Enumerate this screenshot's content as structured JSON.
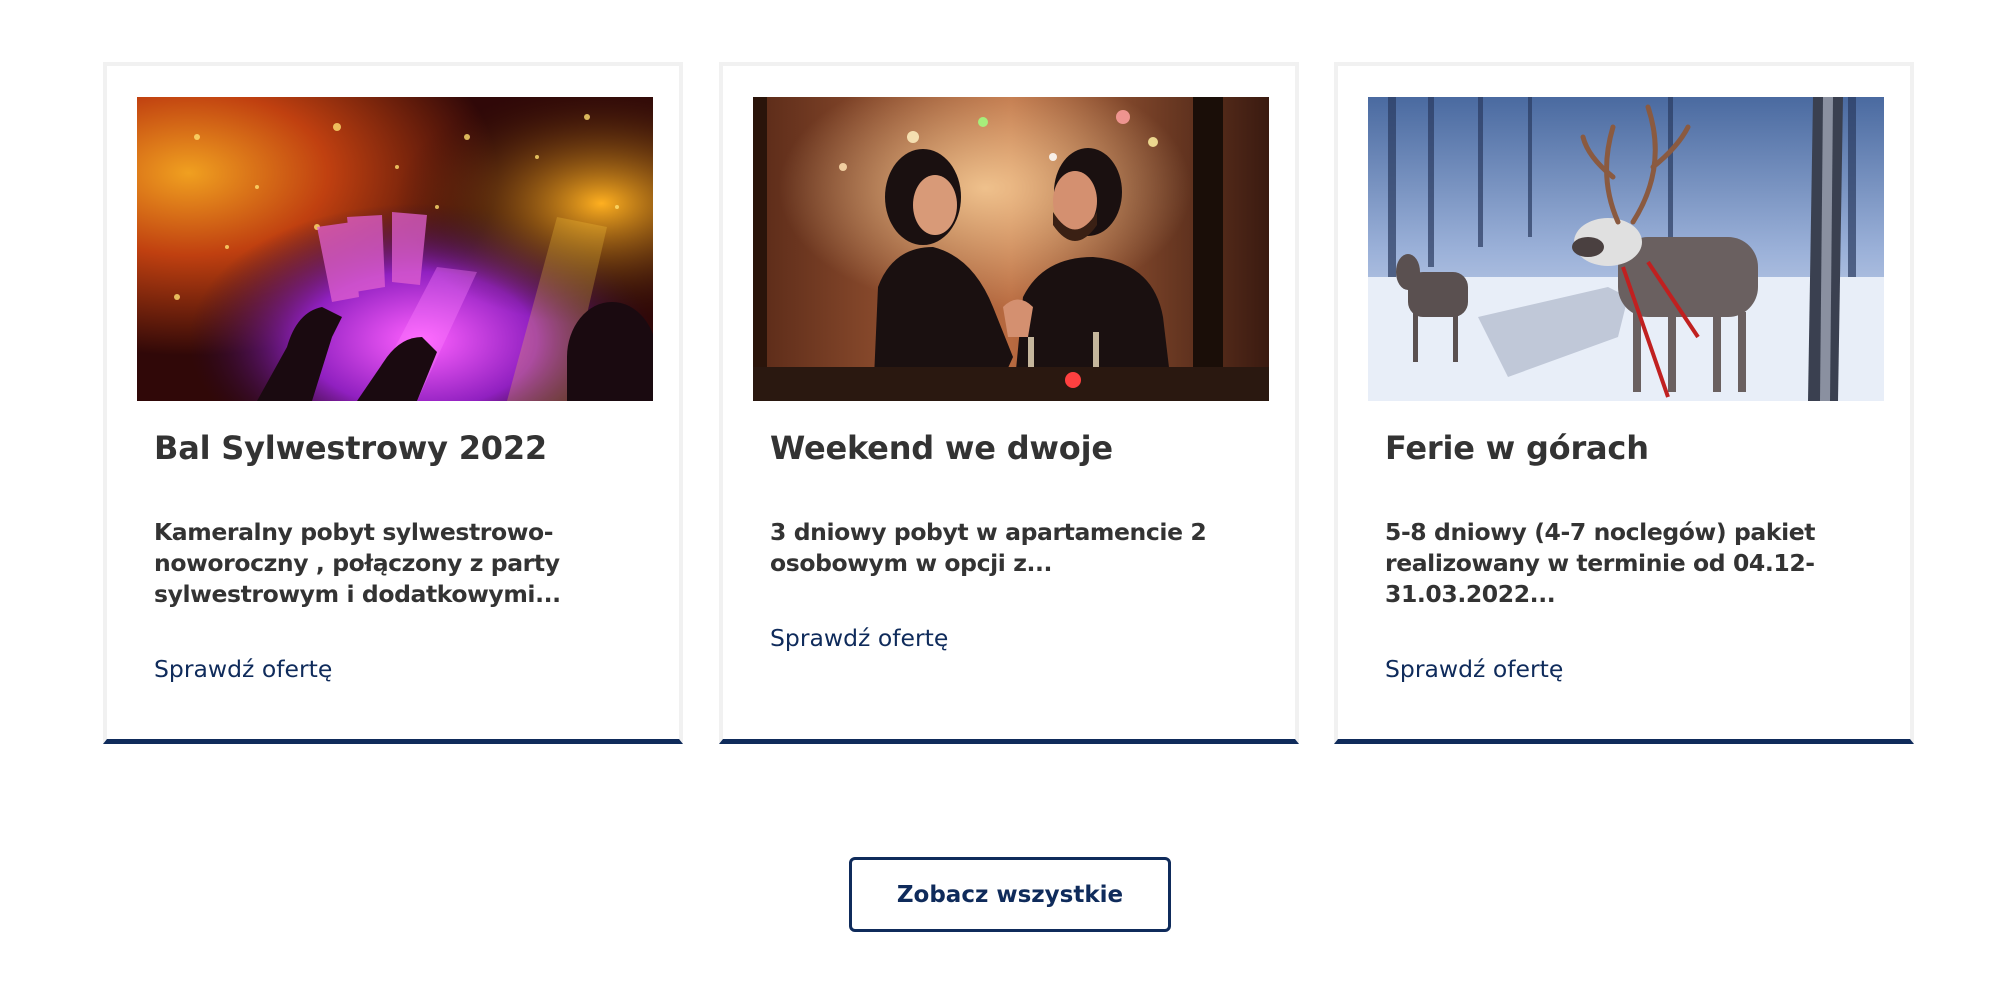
{
  "offers": [
    {
      "title": "Bal Sylwestrowy 2022",
      "description": "Kameralny pobyt sylwestrowo-noworoczny , połączony z  party sylwestrowym i dodatkowymi...",
      "link_label": "Sprawdź ofertę",
      "image": "new-year-party-toast-photo"
    },
    {
      "title": "Weekend we dwoje",
      "description": "3 dniowy pobyt w apartamencie 2 osobowym w opcji z...",
      "link_label": "Sprawdź ofertę",
      "image": "romantic-dinner-couple-photo"
    },
    {
      "title": "Ferie w górach",
      "description": "5-8 dniowy (4-7 noclegów) pakiet realizowany w terminie od 04.12-31.03.2022...",
      "link_label": "Sprawdź ofertę",
      "image": "reindeer-sleigh-winter-photo"
    }
  ],
  "see_all_label": "Zobacz wszystkie",
  "colors": {
    "accent": "#0f2b5b",
    "text": "#333333",
    "card_border": "#f1f1f1"
  }
}
